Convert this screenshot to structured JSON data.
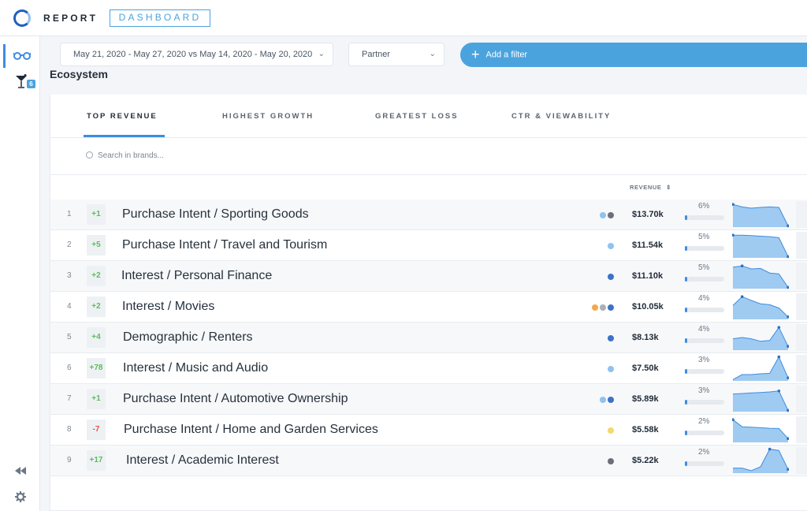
{
  "header": {
    "brand": "REPORT",
    "brand_box": "DASHBOARD"
  },
  "sidebar": {
    "badge": "6",
    "items": [
      "glasses-icon",
      "cocktail-icon"
    ],
    "bottom": [
      "rewind-icon",
      "gear-icon"
    ]
  },
  "filters": {
    "date_range": "May 21, 2020 - May 27, 2020  vs May 14, 2020 - May 20, 2020",
    "partner": "Partner",
    "add_filter": "Add a filter"
  },
  "section_title": "Ecosystem",
  "tabs": [
    {
      "label": "TOP REVENUE",
      "active": true
    },
    {
      "label": "HIGHEST GROWTH",
      "active": false
    },
    {
      "label": "GREATEST LOSS",
      "active": false
    },
    {
      "label": "CTR & VIEWABILITY",
      "active": false
    }
  ],
  "search": {
    "placeholder": "Search in brands..."
  },
  "columns": {
    "revenue": "REVENUE",
    "sort_icon": "sort-icon"
  },
  "colors": {
    "accent": "#3d8de0",
    "light_blue": "#8fc2ef",
    "dark_blue": "#3d72c7",
    "grey": "#6b7078",
    "orange": "#f2a94e",
    "yellow": "#f5d86e",
    "positive": "#5cbd5a",
    "negative": "#e0574a"
  },
  "rows": [
    {
      "rank": "1",
      "delta": "+1",
      "name": "Purchase Intent / Sporting Goods",
      "dots": [
        "#8fc2ef",
        "#6b7078"
      ],
      "revenue": "$13.70k",
      "pct": "6%",
      "share": 0.06,
      "spark": [
        0.9,
        0.8,
        0.75,
        0.78,
        0.8,
        0.78,
        0.05
      ]
    },
    {
      "rank": "2",
      "delta": "+5",
      "name": "Purchase Intent / Travel and Tourism",
      "dots": [
        "#8fc2ef"
      ],
      "revenue": "$11.54k",
      "pct": "5%",
      "share": 0.05,
      "spark": [
        0.9,
        0.9,
        0.88,
        0.86,
        0.84,
        0.8,
        0.05
      ]
    },
    {
      "rank": "3",
      "delta": "+2",
      "name": "Interest / Personal Finance",
      "dots": [
        "#3d72c7"
      ],
      "revenue": "$11.10k",
      "pct": "5%",
      "share": 0.05,
      "spark": [
        0.85,
        0.9,
        0.78,
        0.8,
        0.62,
        0.58,
        0.05
      ]
    },
    {
      "rank": "4",
      "delta": "+2",
      "name": "Interest / Movies",
      "dots": [
        "#f2a94e",
        "#a9b0b8",
        "#3d72c7"
      ],
      "revenue": "$10.05k",
      "pct": "4%",
      "share": 0.04,
      "spark": [
        0.55,
        0.9,
        0.75,
        0.62,
        0.58,
        0.45,
        0.1
      ]
    },
    {
      "rank": "5",
      "delta": "+4",
      "name": "Demographic / Renters",
      "dots": [
        "#3d72c7"
      ],
      "revenue": "$8.13k",
      "pct": "4%",
      "share": 0.04,
      "spark": [
        0.45,
        0.5,
        0.45,
        0.35,
        0.38,
        0.9,
        0.15
      ]
    },
    {
      "rank": "6",
      "delta": "+78",
      "name": "Interest / Music and Audio",
      "dots": [
        "#8fc2ef"
      ],
      "revenue": "$7.50k",
      "pct": "3%",
      "share": 0.03,
      "spark": [
        0.05,
        0.25,
        0.25,
        0.28,
        0.3,
        0.95,
        0.12
      ]
    },
    {
      "rank": "7",
      "delta": "+1",
      "name": "Purchase Intent / Automotive Ownership",
      "dots": [
        "#8fc2ef",
        "#3d72c7"
      ],
      "revenue": "$5.89k",
      "pct": "3%",
      "share": 0.03,
      "spark": [
        0.7,
        0.72,
        0.74,
        0.76,
        0.78,
        0.82,
        0.05
      ]
    },
    {
      "rank": "8",
      "delta": "-7",
      "name": "Purchase Intent / Home and Garden Services",
      "dots": [
        "#f5d86e"
      ],
      "revenue": "$5.58k",
      "pct": "2%",
      "share": 0.02,
      "spark": [
        0.9,
        0.62,
        0.6,
        0.58,
        0.56,
        0.55,
        0.15
      ]
    },
    {
      "rank": "9",
      "delta": "+17",
      "name": "Interest / Academic Interest",
      "dots": [
        "#6b7078"
      ],
      "revenue": "$5.22k",
      "pct": "2%",
      "share": 0.02,
      "spark": [
        0.2,
        0.2,
        0.1,
        0.25,
        0.95,
        0.9,
        0.15
      ]
    }
  ]
}
